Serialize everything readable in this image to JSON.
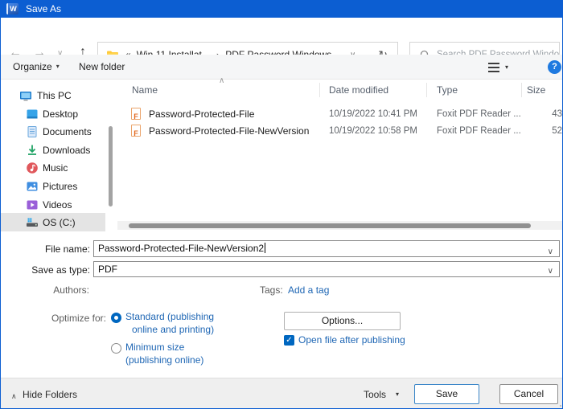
{
  "window": {
    "title": "Save As",
    "app_icon_letter": "W"
  },
  "icons": {
    "back": "←",
    "forward": "→",
    "recent": "∨",
    "up": "↑",
    "address_dropdown": "∨",
    "refresh": "↻",
    "breadcrumb_prefix": "«",
    "breadcrumb_separator": "›",
    "organize_caret": "▾",
    "view_caret": "▾",
    "help": "?",
    "sort_asc": "∧",
    "combo_caret": "∨",
    "tools_caret": "▾",
    "hide_folders_caret": "∧",
    "checkmark": "✓"
  },
  "nav": {
    "breadcrumb": {
      "segment1": "Win 11 Installat...",
      "segment2": "PDF Password Windows"
    },
    "search_placeholder": "Search PDF Password Windo..."
  },
  "toolbar": {
    "organize": "Organize",
    "new_folder": "New folder"
  },
  "sidebar": {
    "items": [
      {
        "label": "This PC"
      },
      {
        "label": "Desktop"
      },
      {
        "label": "Documents"
      },
      {
        "label": "Downloads"
      },
      {
        "label": "Music"
      },
      {
        "label": "Pictures"
      },
      {
        "label": "Videos"
      },
      {
        "label": "OS (C:)",
        "selected": true
      }
    ]
  },
  "file_list": {
    "columns": {
      "name": "Name",
      "date": "Date modified",
      "type": "Type",
      "size": "Size"
    },
    "file_icon_letter": "F",
    "rows": [
      {
        "name": "Password-Protected-File",
        "date": "10/19/2022 10:41 PM",
        "type": "Foxit PDF Reader ...",
        "size": "43"
      },
      {
        "name": "Password-Protected-File-NewVersion",
        "date": "10/19/2022 10:58 PM",
        "type": "Foxit PDF Reader ...",
        "size": "52"
      }
    ]
  },
  "fields": {
    "file_name_label": "File name:",
    "file_name_value": "Password-Protected-File-NewVersion2",
    "save_as_type_label": "Save as type:",
    "save_as_type_value": "PDF",
    "authors_label": "Authors:",
    "tags_label": "Tags:",
    "add_tag_link": "Add a tag",
    "optimize_label": "Optimize for:",
    "optimize_standard_line1": "Standard (publishing",
    "optimize_standard_line2": "online and printing)",
    "optimize_minimum_line1": "Minimum size",
    "optimize_minimum_line2": "(publishing online)",
    "options_button": "Options...",
    "open_file_label": "Open file after publishing"
  },
  "footer": {
    "hide_folders": "Hide Folders",
    "tools": "Tools",
    "save": "Save",
    "cancel": "Cancel"
  },
  "colors": {
    "titlebar_blue": "#0c5ed2",
    "accent_blue": "#0067c0",
    "link_blue": "#1e66b4",
    "save_button_border": "#3c87c8"
  }
}
